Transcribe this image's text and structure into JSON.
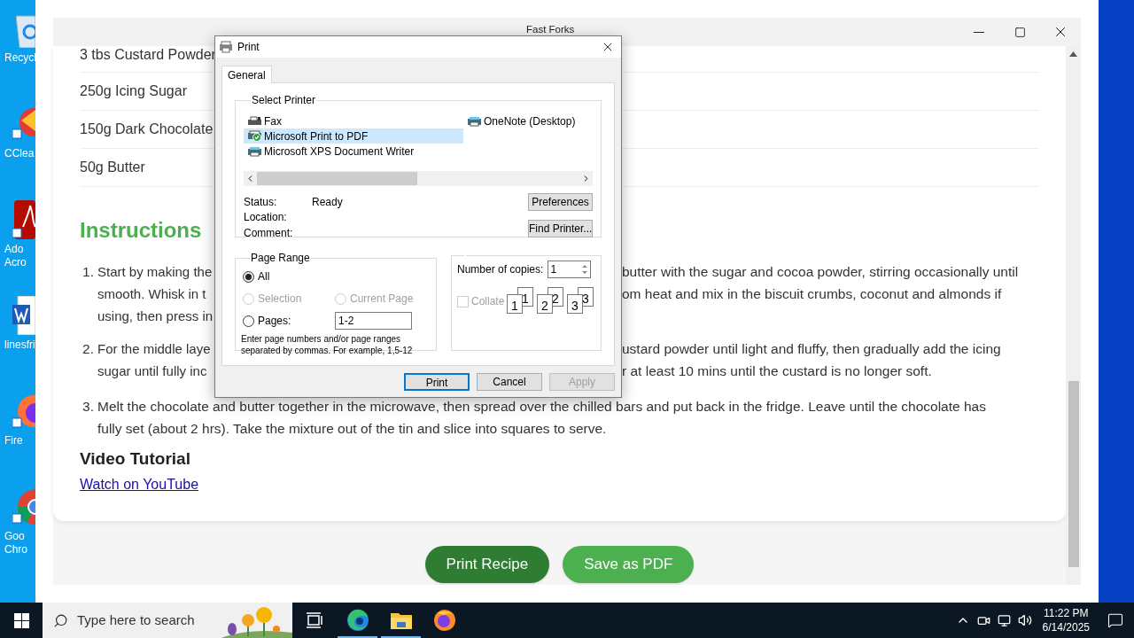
{
  "desktop_icons": [
    {
      "kind": "recycle",
      "lines": [
        "Recycl"
      ]
    },
    {
      "kind": "broom",
      "lines": [
        "CClea"
      ]
    },
    {
      "kind": "acrobat",
      "lines": [
        "Ado",
        "Acro"
      ]
    },
    {
      "kind": "document",
      "lines": [
        "linesfri"
      ]
    },
    {
      "kind": "firefox",
      "lines": [
        "Fire"
      ]
    },
    {
      "kind": "chrome",
      "lines": [
        "Goo",
        "Chro"
      ]
    }
  ],
  "browser": {
    "title": "Fast Forks",
    "ingredients": [
      "3 tbs Custard Powder",
      "250g Icing Sugar",
      "150g Dark Chocolate",
      "50g Butter"
    ],
    "instructions_heading": "Instructions",
    "steps": [
      {
        "number": "1.",
        "lines": [
          {
            "kind": "split",
            "left": "Start by making the",
            "right": "butter with the sugar and cocoa powder, stirring occasionally until"
          },
          {
            "kind": "split",
            "left": "smooth. Whisk in t",
            "right": "om heat and mix in the biscuit crumbs, coconut and almonds if"
          },
          {
            "kind": "split",
            "left": "using, then press in"
          }
        ]
      },
      {
        "number": "2.",
        "lines": [
          {
            "kind": "split",
            "left": "For the middle laye",
            "right": "ustard powder until light and fluffy, then gradually add the icing"
          },
          {
            "kind": "split",
            "left": "sugar until fully inc",
            "right": "r at least 10 mins until the custard is no longer soft."
          }
        ]
      },
      {
        "number": "3.",
        "lines": [
          {
            "kind": "full",
            "left": "Melt the chocolate and butter together in the microwave, then spread over the chilled bars and put back in the fridge. Leave until the chocolate has"
          },
          {
            "kind": "full",
            "left": "fully set (about 2 hrs). Take the mixture out of the tin and slice into squares to serve."
          }
        ]
      }
    ],
    "video_heading": "Video Tutorial",
    "video_link": "Watch on YouTube",
    "buttons": [
      {
        "label": "Print Recipe",
        "color": "#2e7d32"
      },
      {
        "label": "Save as PDF",
        "color": "#4caf50"
      }
    ]
  },
  "print_dialog": {
    "title": "Print",
    "tabs": [
      {
        "label": "General",
        "selected": true
      }
    ],
    "select_printer_label": "Select Printer",
    "printers": [
      {
        "name": "Fax",
        "kind": "fax",
        "selected": false
      },
      {
        "name": "Microsoft Print to PDF",
        "kind": "default",
        "selected": true
      },
      {
        "name": "Microsoft XPS Document Writer",
        "kind": "printer",
        "selected": false
      },
      {
        "name": "OneNote (Desktop)",
        "kind": "printer",
        "selected": false
      }
    ],
    "info": [
      {
        "label": "Status:",
        "value": "Ready"
      },
      {
        "label": "Location:"
      },
      {
        "label": "Comment:"
      }
    ],
    "printer_buttons": [
      "Preferences",
      "Find Printer..."
    ],
    "page_range": {
      "label": "Page Range",
      "options": [
        {
          "label": "All",
          "selected": true,
          "disabled": false
        },
        {
          "label": "Selection",
          "selected": false,
          "disabled": true
        },
        {
          "label": "Current Page",
          "selected": false,
          "disabled": true
        },
        {
          "label": "Pages:",
          "selected": false,
          "disabled": false
        }
      ],
      "pages_value": "1-2",
      "hint": "Enter page numbers and/or page ranges separated by commas.  For example, 1,5-12"
    },
    "copies": {
      "label": "Number of copies:",
      "value": "1",
      "collate": {
        "label": "Collate",
        "checked": false,
        "disabled": true
      },
      "collate_pages": [
        {
          "back": "1",
          "front": "1"
        },
        {
          "back": "2",
          "front": "2"
        },
        {
          "back": "3",
          "front": "3"
        }
      ]
    },
    "buttons": [
      {
        "label": "Print",
        "default": true,
        "disabled": false
      },
      {
        "label": "Cancel",
        "default": false,
        "disabled": false
      },
      {
        "label": "Apply",
        "default": false,
        "disabled": true
      }
    ]
  },
  "taskbar": {
    "search_placeholder": "Type here to search",
    "apps": [
      {
        "kind": "taskview",
        "running": false
      },
      {
        "kind": "edge",
        "running": true
      },
      {
        "kind": "folder",
        "running": true
      },
      {
        "kind": "firefox",
        "running": false
      }
    ],
    "clock": {
      "time": "11:22 PM",
      "date": "6/14/2025"
    }
  }
}
